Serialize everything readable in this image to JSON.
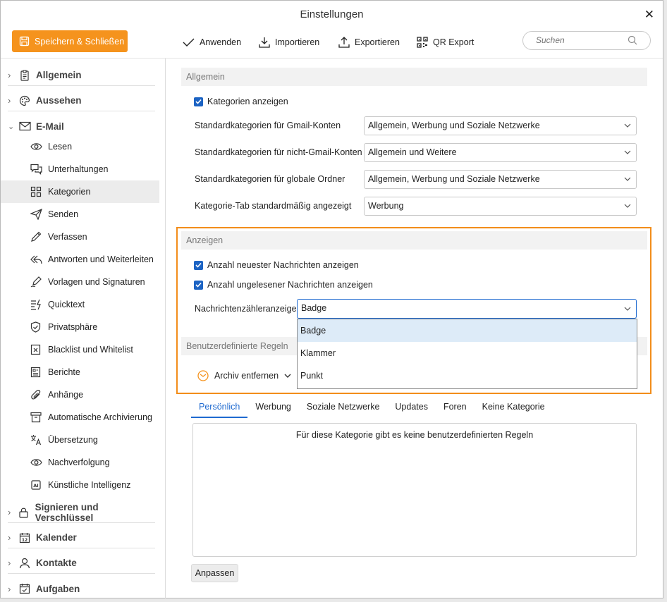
{
  "window": {
    "title": "Einstellungen"
  },
  "toolbar": {
    "save_label": "Speichern & Schließen",
    "apply_label": "Anwenden",
    "import_label": "Importieren",
    "export_label": "Exportieren",
    "qr_label": "QR Export",
    "search_placeholder": "Suchen"
  },
  "sidebar": {
    "sections": {
      "general": "Allgemein",
      "appearance": "Aussehen",
      "email": "E-Mail",
      "sign": "Signieren und Verschlüssel",
      "calendar": "Kalender",
      "contacts": "Kontakte",
      "tasks": "Aufgaben"
    },
    "email_items": [
      {
        "label": "Lesen"
      },
      {
        "label": "Unterhaltungen"
      },
      {
        "label": "Kategorien"
      },
      {
        "label": "Senden"
      },
      {
        "label": "Verfassen"
      },
      {
        "label": "Antworten und Weiterleiten"
      },
      {
        "label": "Vorlagen und Signaturen"
      },
      {
        "label": "Quicktext"
      },
      {
        "label": "Privatsphäre"
      },
      {
        "label": "Blacklist und Whitelist"
      },
      {
        "label": "Berichte"
      },
      {
        "label": "Anhänge"
      },
      {
        "label": "Automatische Archivierung"
      },
      {
        "label": "Übersetzung"
      },
      {
        "label": "Nachverfolgung"
      },
      {
        "label": "Künstliche Intelligenz"
      }
    ]
  },
  "general_group": {
    "title": "Allgemein",
    "show_categories_label": "Kategorien anzeigen",
    "gmail_label": "Standardkategorien für Gmail-Konten",
    "gmail_value": "Allgemein, Werbung und Soziale Netzwerke",
    "non_gmail_label": "Standardkategorien für nicht-Gmail-Konten",
    "non_gmail_value": "Allgemein und Weitere",
    "global_label": "Standardkategorien für globale Ordner",
    "global_value": "Allgemein, Werbung und Soziale Netzwerke",
    "default_tab_label": "Kategorie-Tab standardmäßig angezeigt",
    "default_tab_value": "Werbung"
  },
  "display_group": {
    "title": "Anzeigen",
    "newest_label": "Anzahl neuester Nachrichten anzeigen",
    "unread_label": "Anzahl ungelesener Nachrichten anzeigen",
    "counter_label": "Nachrichtenzähleranzeige",
    "counter_value": "Badge",
    "options": [
      "Badge",
      "Klammer",
      "Punkt"
    ]
  },
  "rules_group": {
    "title": "Benutzerdefinierte Regeln",
    "archive_label": "Archiv entfernen",
    "tabs": [
      "Persönlich",
      "Werbung",
      "Soziale Netzwerke",
      "Updates",
      "Foren",
      "Keine Kategorie"
    ],
    "empty_text": "Für diese Kategorie gibt es keine benutzerdefinierten Regeln",
    "adjust_label": "Anpassen"
  },
  "colors": {
    "accent": "#f5931d",
    "checkbox": "#1c63c3",
    "tab_active": "#1f6ad0",
    "highlight": "#f28d1a"
  }
}
